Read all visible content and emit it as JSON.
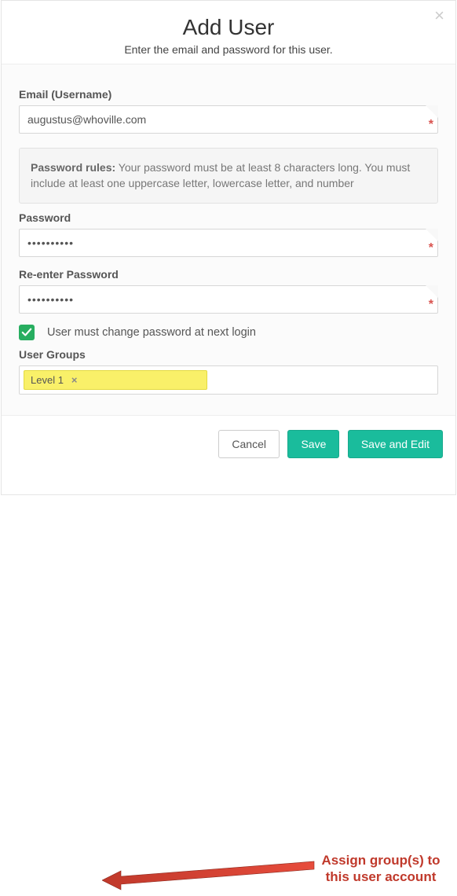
{
  "header": {
    "title": "Add User",
    "subtitle": "Enter the email and password for this user.",
    "close": "×"
  },
  "form": {
    "email_label": "Email (Username)",
    "email_value": "augustus@whoville.com",
    "password_rules_label": "Password rules:",
    "password_rules_text": " Your password must be at least 8 characters long. You must include at least one uppercase letter, lowercase letter, and number",
    "password_label": "Password",
    "password_value": "••••••••••",
    "reenter_label": "Re-enter Password",
    "reenter_value": "••••••••••",
    "checkbox_checked": true,
    "checkbox_label": "User must change password at next login",
    "groups_label": "User Groups",
    "group_tag": "Level 1",
    "tag_x": "×",
    "required_mark": "*"
  },
  "footer": {
    "cancel": "Cancel",
    "save": "Save",
    "save_edit": "Save and Edit"
  },
  "annotation": {
    "text": "Assign group(s) to this user account"
  }
}
